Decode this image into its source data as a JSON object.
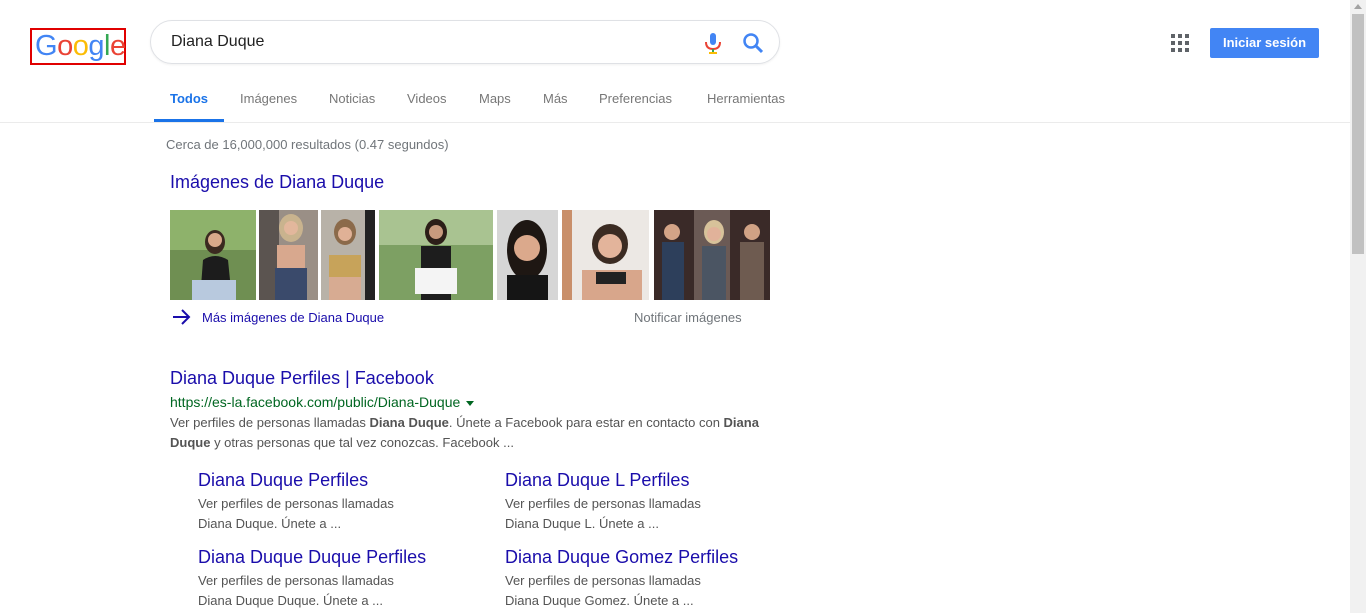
{
  "logo": {
    "text": "Google",
    "letters": [
      {
        "ch": "G",
        "color": "#4285f4"
      },
      {
        "ch": "o",
        "color": "#ea4335"
      },
      {
        "ch": "o",
        "color": "#fbbc05"
      },
      {
        "ch": "g",
        "color": "#4285f4"
      },
      {
        "ch": "l",
        "color": "#34a853"
      },
      {
        "ch": "e",
        "color": "#ea4335"
      }
    ]
  },
  "search": {
    "value": "Diana Duque",
    "mic_icon": "microphone-icon",
    "search_icon": "search-icon"
  },
  "header": {
    "apps_icon": "apps-grid-icon",
    "signin_label": "Iniciar sesión"
  },
  "tabs": [
    "Todos",
    "Imágenes",
    "Noticias",
    "Videos",
    "Maps",
    "Más",
    "Preferencias",
    "Herramientas"
  ],
  "active_tab": "Todos",
  "stats": "Cerca de 16,000,000 resultados (0.47 segundos)",
  "images": {
    "heading": "Imágenes de Diana Duque",
    "more_label": "Más imágenes de Diana Duque",
    "report_label": "Notificar imágenes"
  },
  "result": {
    "title": "Diana Duque Perfiles | Facebook",
    "url": "https://es-la.facebook.com/public/Diana-Duque",
    "snippet_parts": [
      {
        "t": "Ver perfiles de personas llamadas ",
        "b": false
      },
      {
        "t": "Diana Duque",
        "b": true
      },
      {
        "t": ". Únete a Facebook para estar en contacto con ",
        "b": false
      },
      {
        "t": "Diana Duque",
        "b": true
      },
      {
        "t": " y otras personas que tal vez conozcas. Facebook ...",
        "b": false
      }
    ],
    "sitelinks": [
      {
        "title": "Diana Duque Perfiles",
        "line1": "Ver perfiles de personas llamadas",
        "line2": "Diana Duque. Únete a ..."
      },
      {
        "title": "Diana Duque L Perfiles",
        "line1": "Ver perfiles de personas llamadas",
        "line2": "Diana Duque L. Únete a ..."
      },
      {
        "title": "Diana Duque Duque Perfiles",
        "line1": "Ver perfiles de personas llamadas",
        "line2": "Diana Duque Duque. Únete a ..."
      },
      {
        "title": "Diana Duque Gomez Perfiles",
        "line1": "Ver perfiles de personas llamadas",
        "line2": "Diana Duque Gomez. Únete a ..."
      }
    ]
  },
  "colors": {
    "link": "#1a0dab",
    "url": "#006621",
    "accent": "#1a73e8",
    "button": "#4285f4",
    "highlight_box": "#e00000"
  }
}
